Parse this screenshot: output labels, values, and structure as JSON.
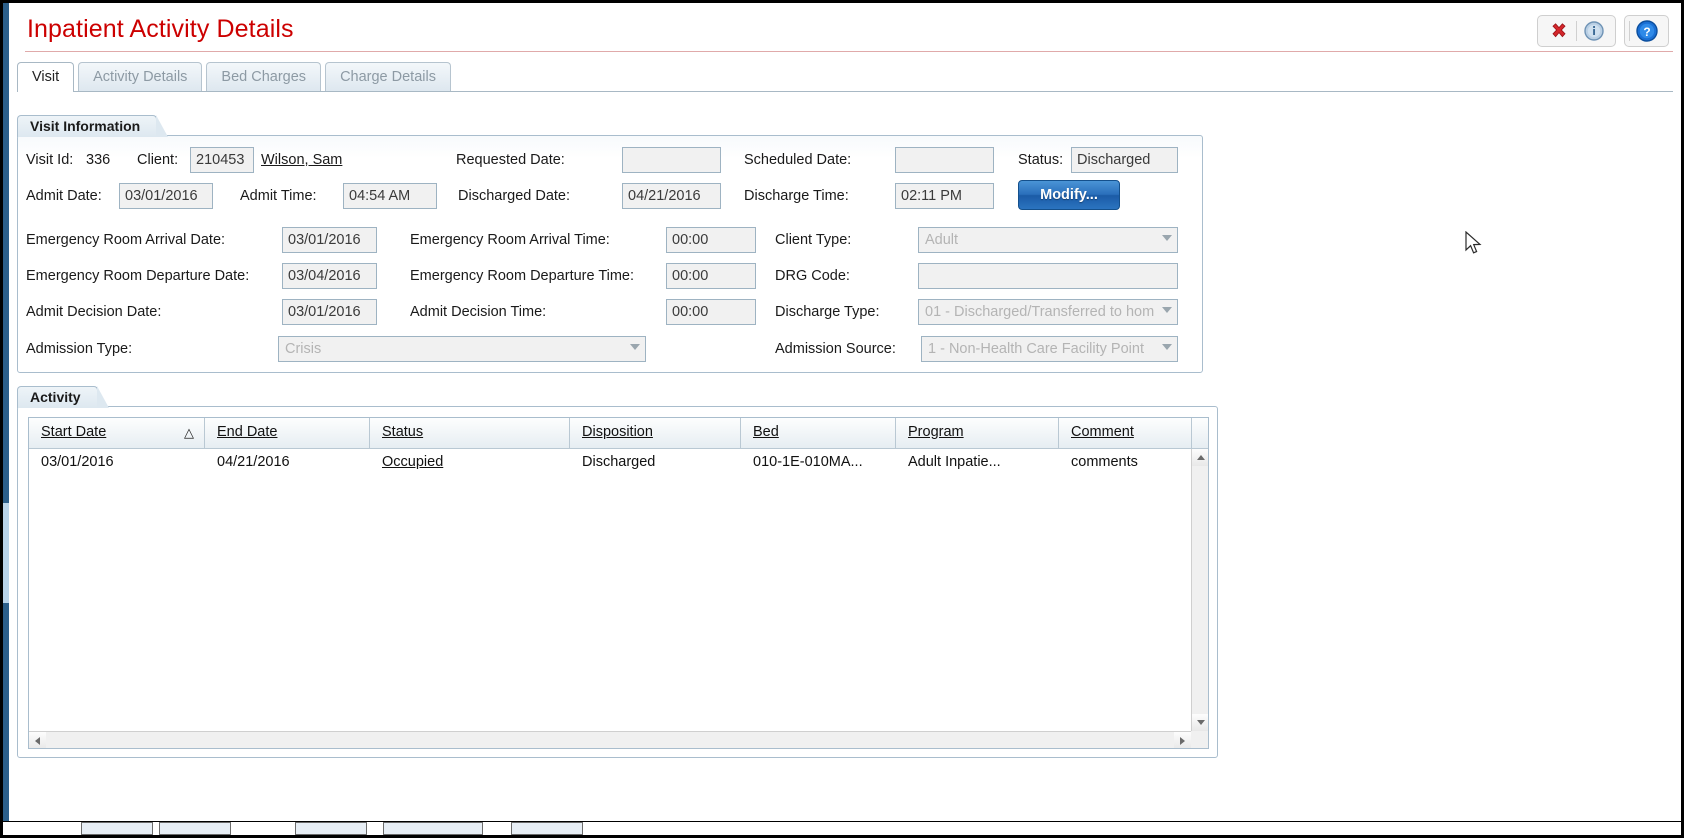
{
  "window": {
    "title": "Inpatient Activity Details",
    "title_color": "#cc0000",
    "header_buttons": [
      {
        "name": "close-icon",
        "glyph": "✖",
        "label": "Close"
      },
      {
        "name": "info-icon",
        "glyph": "i",
        "label": "Information"
      },
      {
        "name": "help-icon",
        "glyph": "?",
        "label": "Help"
      }
    ]
  },
  "tabs": [
    {
      "label": "Visit",
      "active": true
    },
    {
      "label": "Activity Details",
      "active": false
    },
    {
      "label": "Bed Charges",
      "active": false
    },
    {
      "label": "Charge Details",
      "active": false
    }
  ],
  "visit_information": {
    "legend": "Visit Information",
    "visit_id_label": "Visit Id:",
    "visit_id_value": "336",
    "client_label": "Client:",
    "client_id": "210453",
    "client_name": "Wilson, Sam",
    "requested_date_label": "Requested Date:",
    "requested_date_value": "",
    "scheduled_date_label": "Scheduled Date:",
    "scheduled_date_value": "",
    "status_label": "Status:",
    "status_value": "Discharged",
    "admit_date_label": "Admit Date:",
    "admit_date_value": "03/01/2016",
    "admit_time_label": "Admit Time:",
    "admit_time_value": "04:54 AM",
    "discharged_date_label": "Discharged Date:",
    "discharged_date_value": "04/21/2016",
    "discharge_time_label": "Discharge Time:",
    "discharge_time_value": "02:11 PM",
    "modify_button": "Modify...",
    "er_arrival_date_label": "Emergency Room Arrival Date:",
    "er_arrival_date_value": "03/01/2016",
    "er_arrival_time_label": "Emergency Room Arrival Time:",
    "er_arrival_time_value": "00:00",
    "client_type_label": "Client Type:",
    "client_type_value": "Adult",
    "er_departure_date_label": "Emergency Room Departure Date:",
    "er_departure_date_value": "03/04/2016",
    "er_departure_time_label": "Emergency Room Departure Time:",
    "er_departure_time_value": "00:00",
    "drg_code_label": "DRG Code:",
    "drg_code_value": "",
    "admit_decision_date_label": "Admit Decision Date:",
    "admit_decision_date_value": "03/01/2016",
    "admit_decision_time_label": "Admit Decision Time:",
    "admit_decision_time_value": "00:00",
    "discharge_type_label": "Discharge Type:",
    "discharge_type_value": "01 - Discharged/Transferred to hom",
    "admission_type_label": "Admission Type:",
    "admission_type_value": "Crisis",
    "admission_source_label": "Admission Source:",
    "admission_source_value": "1 - Non-Health Care Facility Point"
  },
  "activity": {
    "legend": "Activity",
    "sort_indicator": "△",
    "columns": [
      {
        "label": "Start Date",
        "sorted": true
      },
      {
        "label": "End Date",
        "sorted": false
      },
      {
        "label": "Status",
        "sorted": false
      },
      {
        "label": "Disposition",
        "sorted": false
      },
      {
        "label": "Bed",
        "sorted": false
      },
      {
        "label": "Program",
        "sorted": false
      },
      {
        "label": "Comment",
        "sorted": false
      }
    ],
    "rows": [
      {
        "start_date": "03/01/2016",
        "end_date": "04/21/2016",
        "status": "Occupied",
        "disposition": "Discharged",
        "bed": "010-1E-010MA...",
        "program": "Adult Inpatie...",
        "comment": "comments"
      }
    ]
  }
}
